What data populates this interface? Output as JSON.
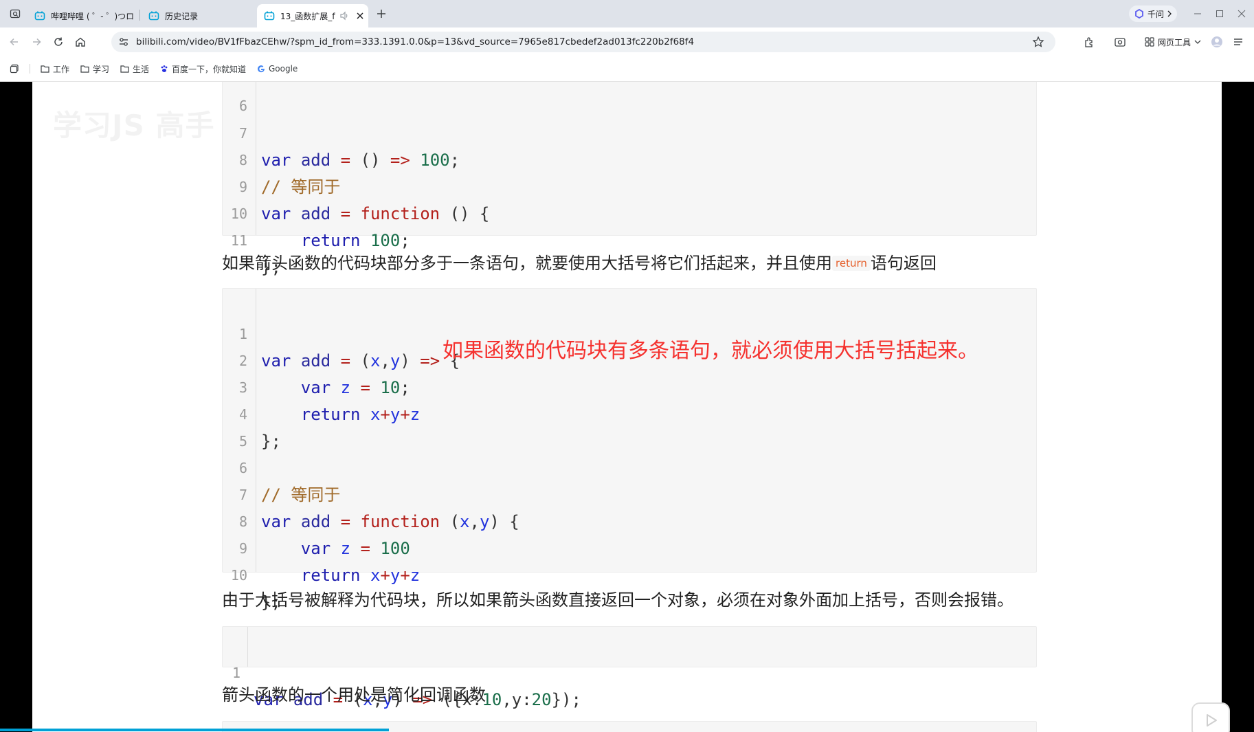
{
  "tabs": [
    {
      "title": "哔哩哔哩 ( ゜- ゜)つロ"
    },
    {
      "title": "历史记录"
    },
    {
      "title": "13_函数扩展_f"
    }
  ],
  "qianwen_label": "千问",
  "url": "bilibili.com/video/BV1fFbazCEhw/?spm_id_from=333.1391.0.0&p=13&vd_source=7965e817cbedef2ad013fc220b2f68f4",
  "web_tools_label": "网页工具",
  "bookmarks": [
    "工作",
    "学习",
    "生活",
    "百度一下，你就知道",
    "Google"
  ],
  "watermark": "学习JS 高手 bilibili",
  "block1": {
    "ln0": "6",
    "ln1": "7",
    "ln2": "8",
    "ln3": "9",
    "ln4": "10",
    "ln5": "11",
    "l1_var": "var",
    "l1_name": "add",
    "l1_eq": "=",
    "l1_parens": "()",
    "l1_arrow": "=>",
    "l1_num": "100",
    "l1_semi": ";",
    "l2_comment": "// 等同于",
    "l3_var": "var",
    "l3_name": "add",
    "l3_eq": "=",
    "l3_fn": "function",
    "l3_rest": "() {",
    "l4_ret": "return",
    "l4_num": "100",
    "l4_semi": ";",
    "l5": "};"
  },
  "para1": {
    "before": "如果箭头函数的代码块部分多于一条语句，就要使用大括号将它们括起来，并且使用",
    "code": "return",
    "after": "语句返回"
  },
  "block2": {
    "ln1": "1",
    "ln2": "2",
    "ln3": "3",
    "ln4": "4",
    "ln5": "5",
    "ln6": "6",
    "ln7": "7",
    "ln8": "8",
    "ln9": "9",
    "ln10": "10",
    "l1_var": "var",
    "l1_name": "add",
    "l1_eq": "=",
    "l1_p1": "(",
    "l1_x": "x",
    "l1_c": ",",
    "l1_y": "y",
    "l1_p2": ")",
    "l1_arrow": "=>",
    "l1_b": "{",
    "l2_var": "var",
    "l2_z": "z",
    "l2_eq": "=",
    "l2_num": "10",
    "l2_semi": ";",
    "l3_ret": "return",
    "l3_x": "x",
    "l3_p1": "+",
    "l3_y": "y",
    "l3_p2": "+",
    "l3_z": "z",
    "l4": "};",
    "l6_comment": "// 等同于",
    "l7_var": "var",
    "l7_name": "add",
    "l7_eq": "=",
    "l7_fn": "function",
    "l7_p1": "(",
    "l7_x": "x",
    "l7_c": ",",
    "l7_y": "y",
    "l7_p2": ") {",
    "l8_var": "var",
    "l8_z": "z",
    "l8_eq": "=",
    "l8_num": "100",
    "l9_ret": "return",
    "l9_x": "x",
    "l9_p1": "+",
    "l9_y": "y",
    "l9_p2": "+",
    "l9_z": "z",
    "l10": "};"
  },
  "annotation": "如果函数的代码块有多条语句，就必须使用大括号括起来。",
  "para2": "由于大括号被解释为代码块，所以如果箭头函数直接返回一个对象，必须在对象外面加上括号，否则会报错。",
  "block3": {
    "ln1": "1",
    "var": "var",
    "name": "add",
    "eq": "=",
    "p1": "(",
    "x": "x",
    "c": ",",
    "y": "y",
    "p2": ")",
    "arrow": "=>",
    "o1": "({x:",
    "n1": "10",
    "o2": ",y:",
    "n2": "20",
    "o3": "});"
  },
  "para3": "箭头函数的一个用处是简化回调函数",
  "video_progress": 0.31
}
